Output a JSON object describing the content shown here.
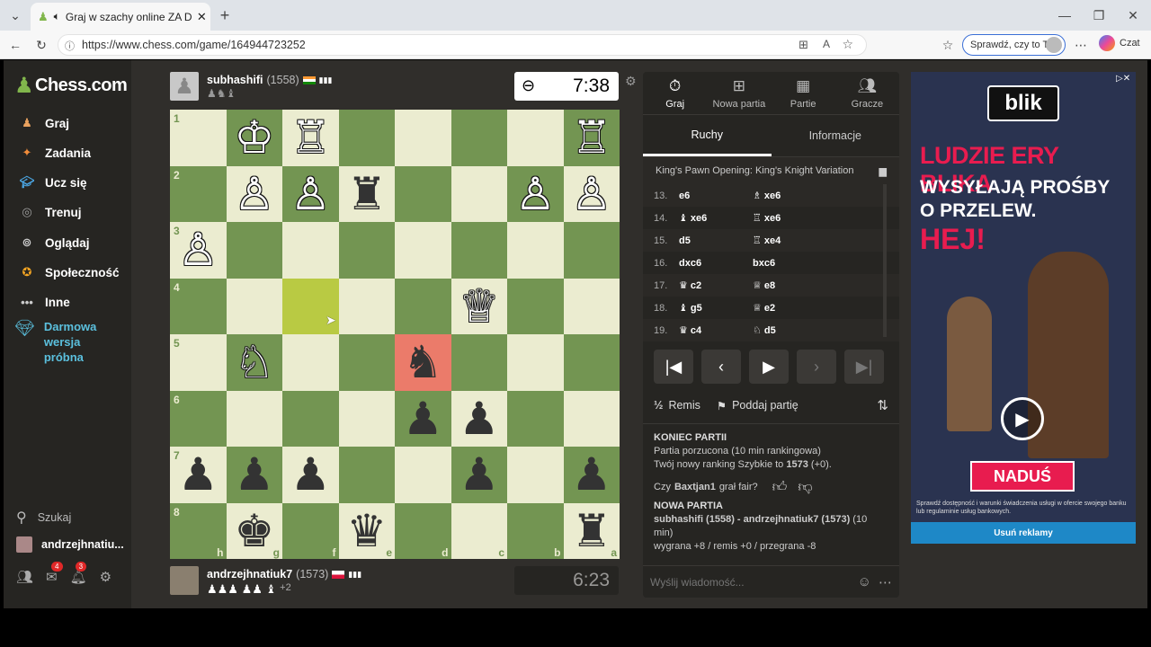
{
  "browser": {
    "tab_title": "Graj w szachy online ZA DARM",
    "url": "https://www.chess.com/game/164944723252",
    "sprawdz": "Sprawdź, czy to Ty",
    "czat": "Czat"
  },
  "sidebar": {
    "logo": "Chess.com",
    "items": [
      {
        "label": "Graj",
        "icon": "pawn-icon",
        "color": "#e9a25f"
      },
      {
        "label": "Zadania",
        "icon": "puzzle-icon",
        "color": "#f28c3a"
      },
      {
        "label": "Ucz się",
        "icon": "graduation-cap-icon",
        "color": "#4aa3df"
      },
      {
        "label": "Trenuj",
        "icon": "target-icon",
        "color": "#a0a0a0"
      },
      {
        "label": "Oglądaj",
        "icon": "binoculars-icon",
        "color": "#cccccc"
      },
      {
        "label": "Społeczność",
        "icon": "community-icon",
        "color": "#f5a623"
      },
      {
        "label": "Inne",
        "icon": "dots-icon",
        "color": "#cccccc"
      }
    ],
    "trial": "Darmowa wersja próbna",
    "search": "Szukaj",
    "username": "andrzejhnatiu...",
    "badges": {
      "messages": "4",
      "notifications": "3"
    }
  },
  "top_player": {
    "name": "subhashifi",
    "rating": "(1558)",
    "clock": "7:38"
  },
  "bottom_player": {
    "name": "andrzejhnatiuk7",
    "rating": "(1573)",
    "extra": "+2",
    "clock": "6:23"
  },
  "board": {
    "ranks": [
      "1",
      "2",
      "3",
      "4",
      "5",
      "6",
      "7",
      "8"
    ],
    "files": [
      "h",
      "g",
      "f",
      "e",
      "d",
      "c",
      "b",
      "a"
    ],
    "rows": [
      [
        "",
        "♔",
        "♖",
        "",
        "",
        "",
        "",
        "♖"
      ],
      [
        "",
        "♙",
        "♙",
        "♜",
        "",
        "",
        "♙",
        "♙"
      ],
      [
        "♙",
        "",
        "",
        "",
        "",
        "",
        "",
        ""
      ],
      [
        "",
        "",
        "",
        "",
        "",
        "♕",
        "",
        ""
      ],
      [
        "",
        "♘",
        "",
        "",
        "♞",
        "",
        "",
        ""
      ],
      [
        "",
        "",
        "",
        "",
        "♟",
        "♟",
        "",
        ""
      ],
      [
        "♟",
        "♟",
        "♟",
        "",
        "",
        "♟",
        "",
        "♟"
      ],
      [
        "",
        "♚",
        "",
        "♛",
        "",
        "",
        "",
        "♜"
      ]
    ],
    "highlight": "f4",
    "red": "d5"
  },
  "panel": {
    "tabs": [
      {
        "label": "Graj",
        "icon": "stopwatch-icon"
      },
      {
        "label": "Nowa partia",
        "icon": "plus-icon"
      },
      {
        "label": "Partie",
        "icon": "board-icon"
      },
      {
        "label": "Gracze",
        "icon": "players-icon"
      }
    ],
    "subtabs": [
      "Ruchy",
      "Informacje"
    ],
    "opening": "King's Pawn Opening: King's Knight Variation",
    "moves": [
      {
        "n": "13.",
        "w": "e6",
        "b": "♗ xe6"
      },
      {
        "n": "14.",
        "w": "♝ xe6",
        "b": "♖ xe6"
      },
      {
        "n": "15.",
        "w": "d5",
        "b": "♖ xe4"
      },
      {
        "n": "16.",
        "w": "dxc6",
        "b": "bxc6"
      },
      {
        "n": "17.",
        "w": "♛ c2",
        "b": "♕ e8"
      },
      {
        "n": "18.",
        "w": "♝ g5",
        "b": "♕ e2"
      },
      {
        "n": "19.",
        "w": "♛ c4",
        "b": "♘ d5"
      }
    ],
    "remis": "Remis",
    "resign": "Poddaj partię",
    "end_title": "KONIEC PARTII",
    "end_line1": "Partia porzucona (10 min rankingowa)",
    "end_line2": "Twój nowy ranking Szybkie to",
    "end_rating": "1573",
    "end_delta": "(+0).",
    "fair_pre": "Czy",
    "fair_name": "Baxtjan1",
    "fair_post": "grał fair?",
    "new_title": "NOWA PARTIA",
    "new_players": "subhashifi (1558) - andrzejhnatiuk7 (1573)",
    "new_time": "(10 min)",
    "new_stakes": "wygrana +8 / remis +0 / przegrana -8",
    "message_placeholder": "Wyślij wiadomość..."
  },
  "ad": {
    "brand": "blik",
    "headline1": "LUDZIE ERY BLIKA",
    "headline2": "WYSYŁAJĄ PROŚBY",
    "headline3": "O PRZELEW.",
    "headline4": "HEJ!",
    "cta": "NADUŚ",
    "disclaimer": "Sprawdź dostępność i warunki świadczenia usługi w ofercie swojego banku lub regulaminie usług bankowych.",
    "remove": "Usuń reklamy"
  }
}
